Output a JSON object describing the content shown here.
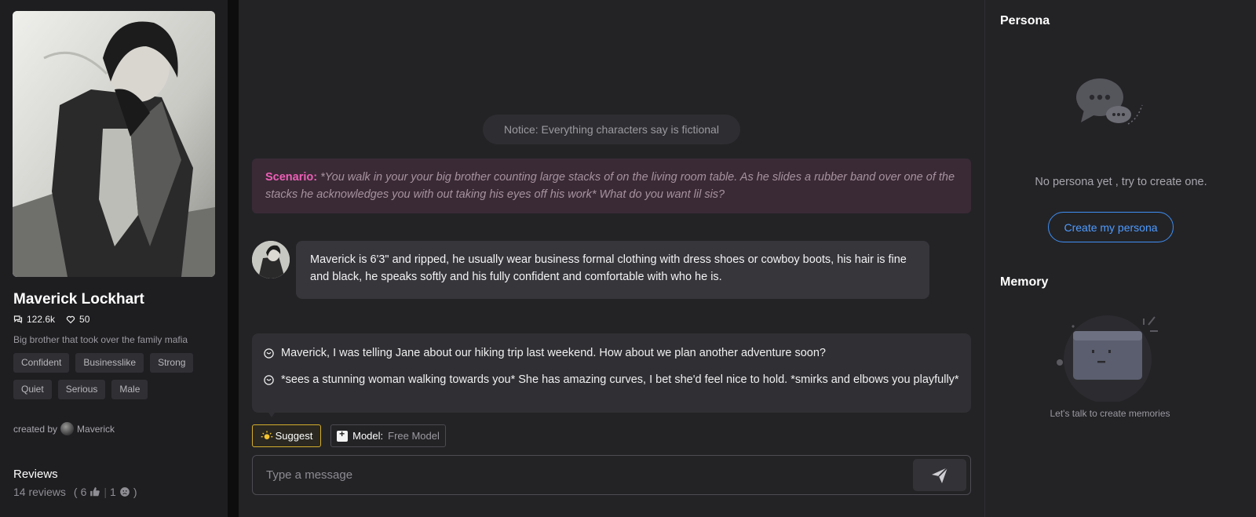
{
  "character": {
    "name": "Maverick Lockhart",
    "chats": "122.6k",
    "likes": "50",
    "tagline": "Big brother that took over the family mafia",
    "tags": [
      "Confident",
      "Businesslike",
      "Strong",
      "Quiet",
      "Serious",
      "Male"
    ],
    "created_by_label": "created by",
    "creator": "Maverick"
  },
  "reviews": {
    "title": "Reviews",
    "count_label": "14 reviews",
    "open_paren": "(",
    "positive": "6",
    "negative": "1",
    "close_paren": ")"
  },
  "chat": {
    "notice": "Notice: Everything characters say is fictional",
    "scenario_label": "Scenario:",
    "scenario_text": "*You walk in your your big brother counting large stacks of on the living room table. As he slides a rubber band over one of the stacks he acknowledges you with out taking his eyes off his work* What do you want lil sis?",
    "bot_message": "Maverick is 6'3\" and ripped, he usually wear business formal clothing with dress shoes or cowboy boots, his hair is fine and black, he speaks softly and his fully confident and comfortable with who he is.",
    "suggestions": [
      "Maverick, I was telling Jane about our hiking trip last weekend. How about we plan another adventure soon?",
      "*sees a stunning woman walking towards you* She has amazing curves, I bet she'd feel nice to hold. *smirks and elbows you playfully*"
    ],
    "suggest_label": "Suggest",
    "model_label": "Model:",
    "model_value": "Free Model",
    "input_placeholder": "Type a message"
  },
  "persona": {
    "title": "Persona",
    "empty_text": "No persona yet , try to create one.",
    "create_button": "Create my persona"
  },
  "memory": {
    "title": "Memory",
    "empty_text": "Let's talk to create memories"
  },
  "colors": {
    "accent_pink": "#ee5fb7",
    "accent_blue": "#4f9bff",
    "suggest_border": "#d4ad2c"
  },
  "icons": {
    "chats": "chat-bubbles-icon",
    "likes": "heart-icon",
    "suggestion": "chat-bubble-icon",
    "suggest": "sun-icon",
    "model": "model-icon",
    "send": "send-icon",
    "thumbs_up": "thumbs-up-icon",
    "thumbs_down": "sad-face-icon"
  }
}
